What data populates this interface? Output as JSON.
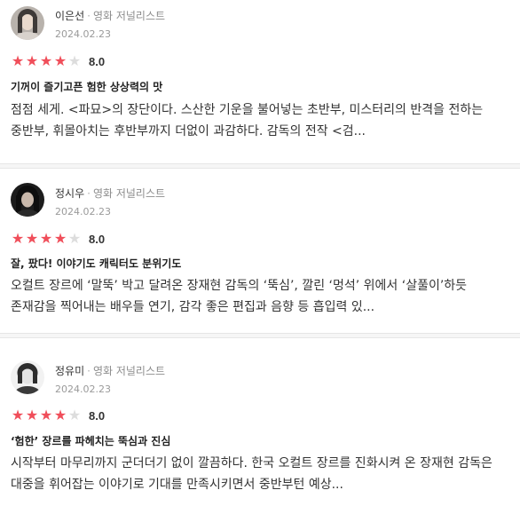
{
  "reviews": [
    {
      "author": "이은선",
      "separator": "·",
      "role": "영화 저널리스트",
      "date": "2024.02.23",
      "rating": 8.0,
      "rating_text": "8.0",
      "stars_filled": 4,
      "stars_total": 5,
      "title": "기꺼이 즐기고픈 험한 상상력의 맛",
      "body": "점점 세게. <파묘>의 장단이다. 스산한 기운을 불어넣는 초반부, 미스터리의 반격을 전하는 중반부, 휘몰아치는 후반부까지 더없이 과감하다. 감독의 전작 <검..."
    },
    {
      "author": "정시우",
      "separator": "·",
      "role": "영화 저널리스트",
      "date": "2024.02.23",
      "rating": 8.0,
      "rating_text": "8.0",
      "stars_filled": 4,
      "stars_total": 5,
      "title": "잘, 팠다! 이야기도 캐릭터도 분위기도",
      "body": "오컬트 장르에 ‘말뚝’ 박고 달려온 장재현 감독의 ‘뚝심’, 깔린 ‘멍석’ 위에서 ‘살풀이’하듯 존재감을 찍어내는 배우들 연기, 감각 좋은 편집과 음향 등 흡입력 있..."
    },
    {
      "author": "정유미",
      "separator": "·",
      "role": "영화 저널리스트",
      "date": "2024.02.23",
      "rating": 8.0,
      "rating_text": "8.0",
      "stars_filled": 4,
      "stars_total": 5,
      "title": "‘험한’ 장르를 파헤치는 뚝심과 진심",
      "body": "시작부터 마무리까지 군더더기 없이 깔끔하다. 한국 오컬트 장르를 진화시켜 온 장재현 감독은 대중을 휘어잡는 이야기로 기대를 만족시키면서 중반부턴 예상..."
    }
  ],
  "colors": {
    "star_filled": "#f04e5a",
    "star_empty": "#dddddd",
    "text_primary": "#222222",
    "text_meta": "#8c8c8c"
  },
  "icons": {
    "star_filled": "★",
    "star_empty": "★"
  }
}
